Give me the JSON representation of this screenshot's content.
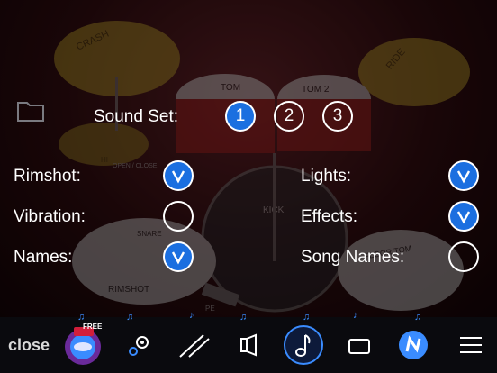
{
  "settings": {
    "sound_set_label": "Sound Set:",
    "sound_sets": [
      "1",
      "2",
      "3"
    ],
    "selected_sound_set": "1",
    "rimshot_label": "Rimshot:",
    "rimshot_on": true,
    "vibration_label": "Vibration:",
    "vibration_on": false,
    "names_label": "Names:",
    "names_on": true,
    "lights_label": "Lights:",
    "lights_on": true,
    "effects_label": "Effects:",
    "effects_on": true,
    "song_names_label": "Song Names:",
    "song_names_on": false
  },
  "background_drum_labels": {
    "crash": "CRASH",
    "ride": "RIDE",
    "tom": "TOM",
    "tom2": "TOM 2",
    "kick": "KICK",
    "floor_tom": "FLOOR TOM",
    "rimshot": "RIMSHOT",
    "snare": "SNARE",
    "hihat": "HI",
    "open_close": "OPEN / CLOSE",
    "pedal": "PE"
  },
  "toolbar": {
    "close_label": "close",
    "free_badge": "FREE",
    "icons": [
      "free-app-icon",
      "settings-icon",
      "drumsticks-icon",
      "speaker-icon",
      "music-note-icon",
      "window-icon",
      "brand-logo-icon",
      "menu-icon"
    ]
  },
  "colors": {
    "toggle_on": "#1b6fe0",
    "accent_note": "#3a8cff",
    "toolbar_bg": "#0a0a0e"
  }
}
